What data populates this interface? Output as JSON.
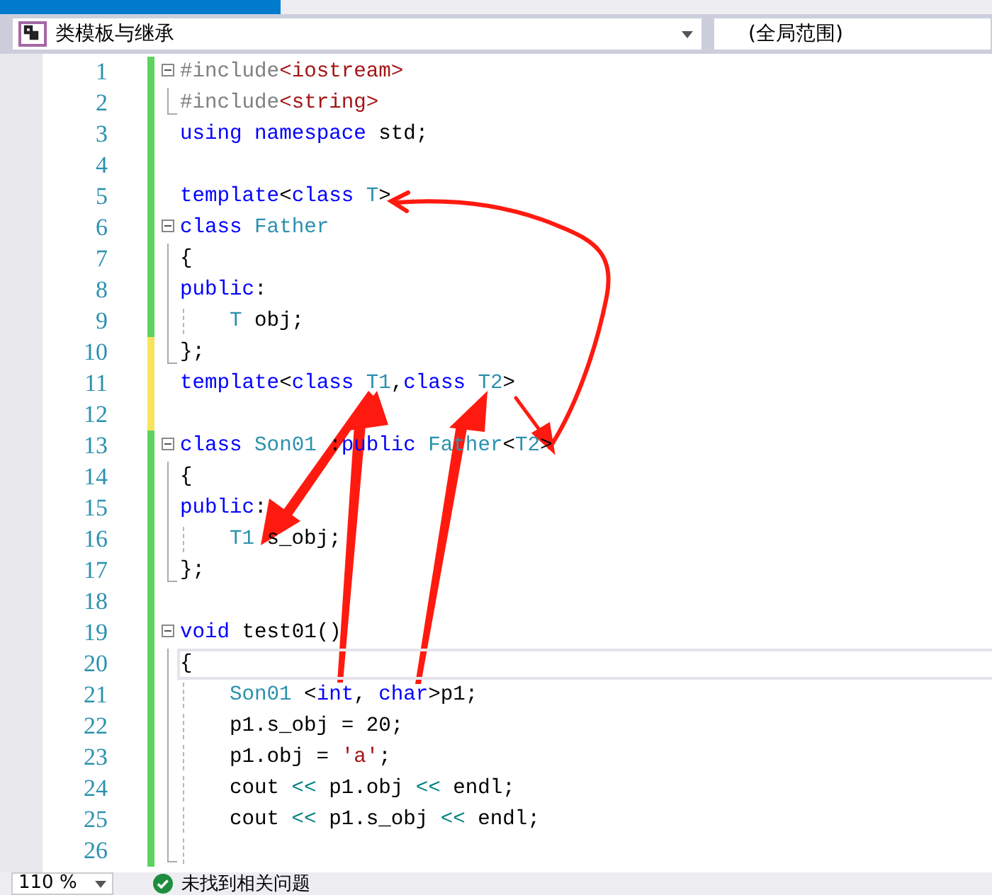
{
  "navigation_bar": {
    "file_scope": "类模板与继承",
    "member_scope": "(全局范围)"
  },
  "editor": {
    "lines": [
      {
        "number": "1",
        "modified": false,
        "expanded": true,
        "tokens": [
          {
            "text": "#include",
            "kind": "pre"
          },
          {
            "text": "<iostream>",
            "kind": "str"
          }
        ],
        "children": [
          {
            "number": "2",
            "modified": false,
            "tokens": [
              {
                "text": "#include",
                "kind": "pre"
              },
              {
                "text": "<string>",
                "kind": "str"
              }
            ]
          }
        ]
      },
      {
        "number": "3",
        "modified": false,
        "tokens": [
          {
            "text": "using",
            "kind": "kw"
          },
          {
            "text": " namespace",
            "kind": "kw"
          },
          {
            "text": " std;",
            "kind": "plain"
          }
        ]
      },
      {
        "number": "4",
        "modified": false
      },
      {
        "number": "5",
        "modified": false,
        "tokens": [
          {
            "text": "template",
            "kind": "kw"
          },
          {
            "text": "<",
            "kind": "plain"
          },
          {
            "text": "class",
            "kind": "kw"
          },
          {
            "text": " T",
            "kind": "type"
          },
          {
            "text": ">",
            "kind": "plain"
          }
        ]
      },
      {
        "number": "6",
        "modified": false,
        "expanded": true,
        "tokens": [
          {
            "text": "class",
            "kind": "kw"
          },
          {
            "text": " Father",
            "kind": "type"
          }
        ],
        "children": [
          {
            "number": "7",
            "modified": false,
            "tokens": [
              {
                "text": "{",
                "kind": "plain"
              }
            ]
          },
          {
            "number": "8",
            "modified": false,
            "tokens": [
              {
                "text": "public",
                "kind": "kw"
              },
              {
                "text": ":",
                "kind": "plain"
              }
            ]
          },
          {
            "number": "9",
            "modified": false,
            "indented": true,
            "tokens": [
              {
                "text": "T",
                "kind": "type"
              },
              {
                "text": " obj;",
                "kind": "plain"
              }
            ]
          },
          {
            "number": "10",
            "modified": true,
            "tokens": [
              {
                "text": "};",
                "kind": "plain"
              }
            ]
          }
        ]
      },
      {
        "number": "11",
        "modified": true,
        "tokens": [
          {
            "text": "template",
            "kind": "kw"
          },
          {
            "text": "<",
            "kind": "plain"
          },
          {
            "text": "class",
            "kind": "kw"
          },
          {
            "text": " T1",
            "kind": "type"
          },
          {
            "text": ",",
            "kind": "plain"
          },
          {
            "text": "class",
            "kind": "kw"
          },
          {
            "text": " T2",
            "kind": "type"
          },
          {
            "text": ">",
            "kind": "plain"
          }
        ]
      },
      {
        "number": "12",
        "modified": true
      },
      {
        "number": "13",
        "modified": false,
        "expanded": true,
        "tokens": [
          {
            "text": "class",
            "kind": "kw"
          },
          {
            "text": " Son01",
            "kind": "type"
          },
          {
            "text": " :",
            "kind": "plain"
          },
          {
            "text": "public",
            "kind": "kw"
          },
          {
            "text": " Father",
            "kind": "type"
          },
          {
            "text": "<",
            "kind": "plain"
          },
          {
            "text": "T2",
            "kind": "type"
          },
          {
            "text": ">",
            "kind": "plain"
          }
        ],
        "children": [
          {
            "number": "14",
            "modified": false,
            "tokens": [
              {
                "text": "{",
                "kind": "plain"
              }
            ]
          },
          {
            "number": "15",
            "modified": false,
            "tokens": [
              {
                "text": "public",
                "kind": "kw"
              },
              {
                "text": ":",
                "kind": "plain"
              }
            ]
          },
          {
            "number": "16",
            "modified": false,
            "indented": true,
            "tokens": [
              {
                "text": "T1",
                "kind": "type"
              },
              {
                "text": " s_obj;",
                "kind": "plain"
              }
            ]
          },
          {
            "number": "17",
            "modified": false,
            "tokens": [
              {
                "text": "};",
                "kind": "plain"
              }
            ]
          }
        ]
      },
      {
        "number": "18",
        "modified": false
      },
      {
        "number": "19",
        "modified": false,
        "expanded": true,
        "tokens": [
          {
            "text": "void",
            "kind": "kw"
          },
          {
            "text": " test01()",
            "kind": "plain"
          }
        ],
        "children": [
          {
            "number": "20",
            "modified": false,
            "current": true,
            "tokens": [
              {
                "text": "{",
                "kind": "plain"
              }
            ]
          },
          {
            "number": "21",
            "modified": false,
            "indented": true,
            "tokens": [
              {
                "text": "Son01",
                "kind": "type"
              },
              {
                "text": " <",
                "kind": "plain"
              },
              {
                "text": "int",
                "kind": "kw"
              },
              {
                "text": ", ",
                "kind": "plain"
              },
              {
                "text": "char",
                "kind": "kw"
              },
              {
                "text": ">p1;",
                "kind": "plain"
              }
            ]
          },
          {
            "number": "22",
            "modified": false,
            "indented": true,
            "tokens": [
              {
                "text": "p1.s_obj = 20;",
                "kind": "plain"
              }
            ]
          },
          {
            "number": "23",
            "modified": false,
            "indented": true,
            "tokens": [
              {
                "text": "p1.obj = ",
                "kind": "plain"
              },
              {
                "text": "'a'",
                "kind": "str"
              },
              {
                "text": ";",
                "kind": "plain"
              }
            ]
          },
          {
            "number": "24",
            "modified": false,
            "indented": true,
            "tokens": [
              {
                "text": "cout ",
                "kind": "plain"
              },
              {
                "text": "<<",
                "kind": "op"
              },
              {
                "text": " p1.obj ",
                "kind": "plain"
              },
              {
                "text": "<<",
                "kind": "op"
              },
              {
                "text": " endl;",
                "kind": "plain"
              }
            ]
          },
          {
            "number": "25",
            "modified": false,
            "indented": true,
            "tokens": [
              {
                "text": "cout ",
                "kind": "plain"
              },
              {
                "text": "<<",
                "kind": "op"
              },
              {
                "text": " p1.s_obj ",
                "kind": "plain"
              },
              {
                "text": "<<",
                "kind": "op"
              },
              {
                "text": " endl;",
                "kind": "plain"
              }
            ]
          },
          {
            "number": "26",
            "modified": false,
            "indented": true
          }
        ]
      }
    ]
  },
  "status_bar": {
    "zoom": "110 %",
    "issues": "未找到相关问题"
  }
}
